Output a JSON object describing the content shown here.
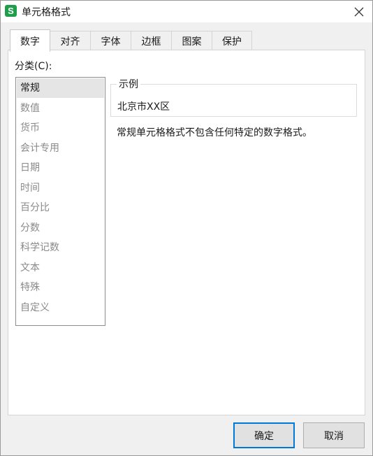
{
  "window": {
    "title": "单元格格式",
    "app_icon_letter": "S",
    "close_glyph": "✕"
  },
  "tabs": [
    {
      "label": "数字",
      "active": true
    },
    {
      "label": "对齐"
    },
    {
      "label": "字体"
    },
    {
      "label": "边框"
    },
    {
      "label": "图案"
    },
    {
      "label": "保护"
    }
  ],
  "category": {
    "label": "分类(C):",
    "selected": "常规",
    "items": [
      "常规",
      "数值",
      "货币",
      "会计专用",
      "日期",
      "时间",
      "百分比",
      "分数",
      "科学记数",
      "文本",
      "特殊",
      "自定义"
    ]
  },
  "sample": {
    "legend": "示例",
    "value": "北京市XX区"
  },
  "description": "常规单元格格式不包含任何特定的数字格式。",
  "buttons": {
    "ok": "确定",
    "cancel": "取消"
  },
  "colors": {
    "accent": "#0078d7",
    "app_icon": "#1e9e4a"
  }
}
